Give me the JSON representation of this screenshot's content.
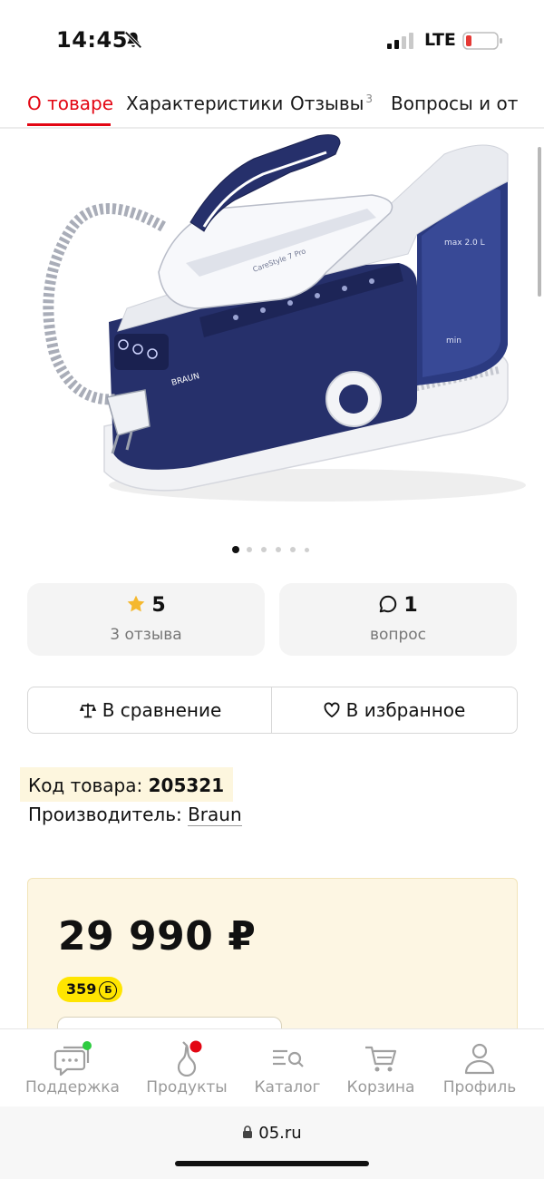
{
  "status": {
    "time": "14:45",
    "network": "LTE",
    "icons": [
      "bell-slash-icon",
      "signal-icon",
      "battery-low-icon"
    ],
    "battery_color": "#e53935"
  },
  "tabs": [
    {
      "label": "О товаре",
      "active": true
    },
    {
      "label": "Характеристики",
      "active": false
    },
    {
      "label": "Отзывы",
      "count": "3",
      "active": false
    },
    {
      "label": "Вопросы и от",
      "active": false
    }
  ],
  "product_image": {
    "brand_text": "BRAUN",
    "model_text": "CareStyle 7 Pro",
    "max_text": "max 2.0 L",
    "min_text": "min",
    "total_slides": 6,
    "active_slide": 1
  },
  "rating": {
    "value": "5",
    "label": "3 отзыва",
    "icon": "star-icon",
    "star_color": "#f5b82e"
  },
  "questions": {
    "value": "1",
    "label": "вопрос",
    "icon": "chat-bubble-icon"
  },
  "actions": {
    "compare_label": "В сравнение",
    "compare_icon": "scales-icon",
    "favorite_label": "В избранное",
    "favorite_icon": "heart-icon"
  },
  "info": {
    "sku_label": "Код товара:",
    "sku_value": "205321",
    "maker_label": "Производитель:",
    "maker_value": "Braun"
  },
  "price": {
    "value": "29 990 ₽",
    "bonus": "359",
    "bonus_symbol": "Б"
  },
  "bottom_nav": [
    {
      "label": "Поддержка",
      "icon": "chat-support-icon",
      "badge_color": "#2ecc40"
    },
    {
      "label": "Продукты",
      "icon": "pear-icon",
      "badge_color": "#e30613"
    },
    {
      "label": "Каталог",
      "icon": "catalog-search-icon"
    },
    {
      "label": "Корзина",
      "icon": "cart-icon"
    },
    {
      "label": "Профиль",
      "icon": "profile-icon"
    }
  ],
  "browser": {
    "url": "05.ru"
  },
  "colors": {
    "accent": "#e30613",
    "price_card_bg": "#fdf6e3",
    "bonus_badge": "#ffe500"
  }
}
